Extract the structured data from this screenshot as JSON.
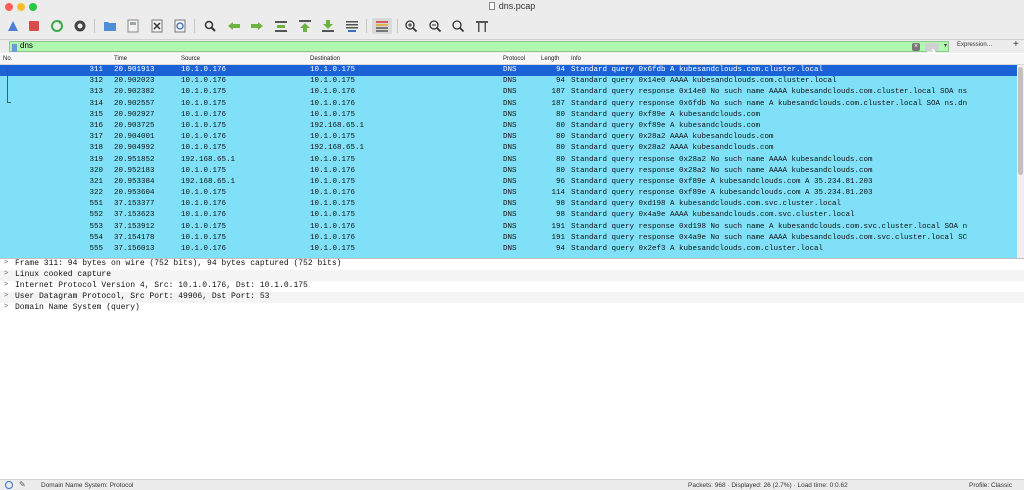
{
  "window": {
    "title": "dns.pcap"
  },
  "colors": {
    "row_bg": "#7fe0f7",
    "selected_bg": "#1b62d6",
    "filter_bg": "#b0f7b0"
  },
  "toolbar": {
    "icons": [
      "start-capture-icon",
      "stop-capture-icon",
      "restart-capture-icon",
      "capture-options-icon",
      "open-file-icon",
      "save-file-icon",
      "close-file-icon",
      "reload-file-icon",
      "find-packet-icon",
      "go-back-icon",
      "go-forward-icon",
      "go-to-packet-icon",
      "first-packet-icon",
      "last-packet-icon",
      "autoscroll-icon",
      "colorize-icon",
      "zoom-in-icon",
      "zoom-out-icon",
      "normal-size-icon",
      "resize-columns-icon"
    ]
  },
  "filter": {
    "value": "dns",
    "expression_label": "Expression…",
    "plus_label": "+"
  },
  "columns": {
    "no": "No.",
    "time": "Time",
    "source": "Source",
    "destination": "Destination",
    "protocol": "Protocol",
    "length": "Length",
    "info": "Info"
  },
  "packets": [
    {
      "no": "311",
      "time": "20.901913",
      "src": "10.1.0.176",
      "dst": "10.1.0.175",
      "proto": "DNS",
      "len": "94",
      "info": "Standard query 0x6fdb A kubesandclouds.com.cluster.local"
    },
    {
      "no": "312",
      "time": "20.902023",
      "src": "10.1.0.176",
      "dst": "10.1.0.175",
      "proto": "DNS",
      "len": "94",
      "info": "Standard query 0x14e0 AAAA kubesandclouds.com.cluster.local"
    },
    {
      "no": "313",
      "time": "20.902382",
      "src": "10.1.0.175",
      "dst": "10.1.0.176",
      "proto": "DNS",
      "len": "187",
      "info": "Standard query response 0x14e0 No such name AAAA kubesandclouds.com.cluster.local SOA ns"
    },
    {
      "no": "314",
      "time": "20.902557",
      "src": "10.1.0.175",
      "dst": "10.1.0.176",
      "proto": "DNS",
      "len": "187",
      "info": "Standard query response 0x6fdb No such name A kubesandclouds.com.cluster.local SOA ns.dn"
    },
    {
      "no": "315",
      "time": "20.902927",
      "src": "10.1.0.176",
      "dst": "10.1.0.175",
      "proto": "DNS",
      "len": "80",
      "info": "Standard query 0xf89e A kubesandclouds.com"
    },
    {
      "no": "316",
      "time": "20.903725",
      "src": "10.1.0.175",
      "dst": "192.168.65.1",
      "proto": "DNS",
      "len": "80",
      "info": "Standard query 0xf89e A kubesandclouds.com"
    },
    {
      "no": "317",
      "time": "20.904001",
      "src": "10.1.0.176",
      "dst": "10.1.0.175",
      "proto": "DNS",
      "len": "80",
      "info": "Standard query 0x28a2 AAAA kubesandclouds.com"
    },
    {
      "no": "318",
      "time": "20.904992",
      "src": "10.1.0.175",
      "dst": "192.168.65.1",
      "proto": "DNS",
      "len": "80",
      "info": "Standard query 0x28a2 AAAA kubesandclouds.com"
    },
    {
      "no": "319",
      "time": "20.951852",
      "src": "192.168.65.1",
      "dst": "10.1.0.175",
      "proto": "DNS",
      "len": "80",
      "info": "Standard query response 0x28a2 No such name AAAA kubesandclouds.com"
    },
    {
      "no": "320",
      "time": "20.952183",
      "src": "10.1.0.175",
      "dst": "10.1.0.176",
      "proto": "DNS",
      "len": "80",
      "info": "Standard query response 0x28a2 No such name AAAA kubesandclouds.com"
    },
    {
      "no": "321",
      "time": "20.953384",
      "src": "192.168.65.1",
      "dst": "10.1.0.175",
      "proto": "DNS",
      "len": "96",
      "info": "Standard query response 0xf89e A kubesandclouds.com A 35.234.81.203"
    },
    {
      "no": "322",
      "time": "20.953604",
      "src": "10.1.0.175",
      "dst": "10.1.0.176",
      "proto": "DNS",
      "len": "114",
      "info": "Standard query response 0xf89e A kubesandclouds.com A 35.234.81.203"
    },
    {
      "no": "551",
      "time": "37.153377",
      "src": "10.1.0.176",
      "dst": "10.1.0.175",
      "proto": "DNS",
      "len": "98",
      "info": "Standard query 0xd198 A kubesandclouds.com.svc.cluster.local"
    },
    {
      "no": "552",
      "time": "37.153623",
      "src": "10.1.0.176",
      "dst": "10.1.0.175",
      "proto": "DNS",
      "len": "98",
      "info": "Standard query 0x4a9e AAAA kubesandclouds.com.svc.cluster.local"
    },
    {
      "no": "553",
      "time": "37.153912",
      "src": "10.1.0.175",
      "dst": "10.1.0.176",
      "proto": "DNS",
      "len": "191",
      "info": "Standard query response 0xd198 No such name A kubesandclouds.com.svc.cluster.local SOA n"
    },
    {
      "no": "554",
      "time": "37.154178",
      "src": "10.1.0.175",
      "dst": "10.1.0.176",
      "proto": "DNS",
      "len": "191",
      "info": "Standard query response 0x4a9e No such name AAAA kubesandclouds.com.svc.cluster.local SC"
    },
    {
      "no": "555",
      "time": "37.156013",
      "src": "10.1.0.176",
      "dst": "10.1.0.175",
      "proto": "DNS",
      "len": "94",
      "info": "Standard query 0x2ef3 A kubesandclouds.com.cluster.local"
    }
  ],
  "details": [
    "Frame 311: 94 bytes on wire (752 bits), 94 bytes captured (752 bits)",
    "Linux cooked capture",
    "Internet Protocol Version 4, Src: 10.1.0.176, Dst: 10.1.0.175",
    "User Datagram Protocol, Src Port: 49906, Dst Port: 53",
    "Domain Name System (query)"
  ],
  "status": {
    "field": "Domain Name System: Protocol",
    "packets": "Packets: 968 · Displayed: 26 (2.7%) · Load time: 0:0.62",
    "profile": "Profile: Classic"
  }
}
